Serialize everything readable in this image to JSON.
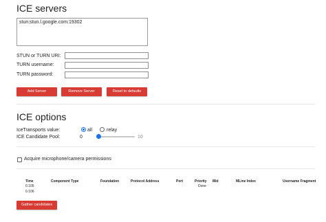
{
  "ice_servers": {
    "heading": "ICE servers",
    "list": [
      "stun:stun.l.google.com:19302"
    ],
    "stun_turn_uri_label": "STUN or TURN URI:",
    "turn_username_label": "TURN username:",
    "turn_password_label": "TURN password:",
    "stun_turn_uri_value": "",
    "turn_username_value": "",
    "turn_password_value": "",
    "add_server_label": "Add Server",
    "remove_server_label": "Remove Server",
    "reset_label": "Reset to defaults"
  },
  "ice_options": {
    "heading": "ICE options",
    "transports_label": "IceTransports value:",
    "transport_all": "all",
    "transport_relay": "relay",
    "selected_transport": "all",
    "pool_label": "ICE Candidate Pool:",
    "pool_value": "0",
    "pool_min": "0",
    "pool_max": "10",
    "acquire_label": "Acquire microphone/camera permissions",
    "acquire_checked": false
  },
  "candidates_table": {
    "columns": [
      "Time",
      "Component Type",
      "Foundation",
      "Protocol Address",
      "Port",
      "Priority",
      "Mid",
      "MLine Index",
      "Username Fragment"
    ],
    "rows": [
      {
        "time": "0.105",
        "priority": "Done"
      },
      {
        "time": "0.106",
        "priority": ""
      }
    ]
  },
  "gather_label": "Gather candidates",
  "colors": {
    "accent_red": "#d83b33",
    "control_blue": "#1a73e8"
  }
}
